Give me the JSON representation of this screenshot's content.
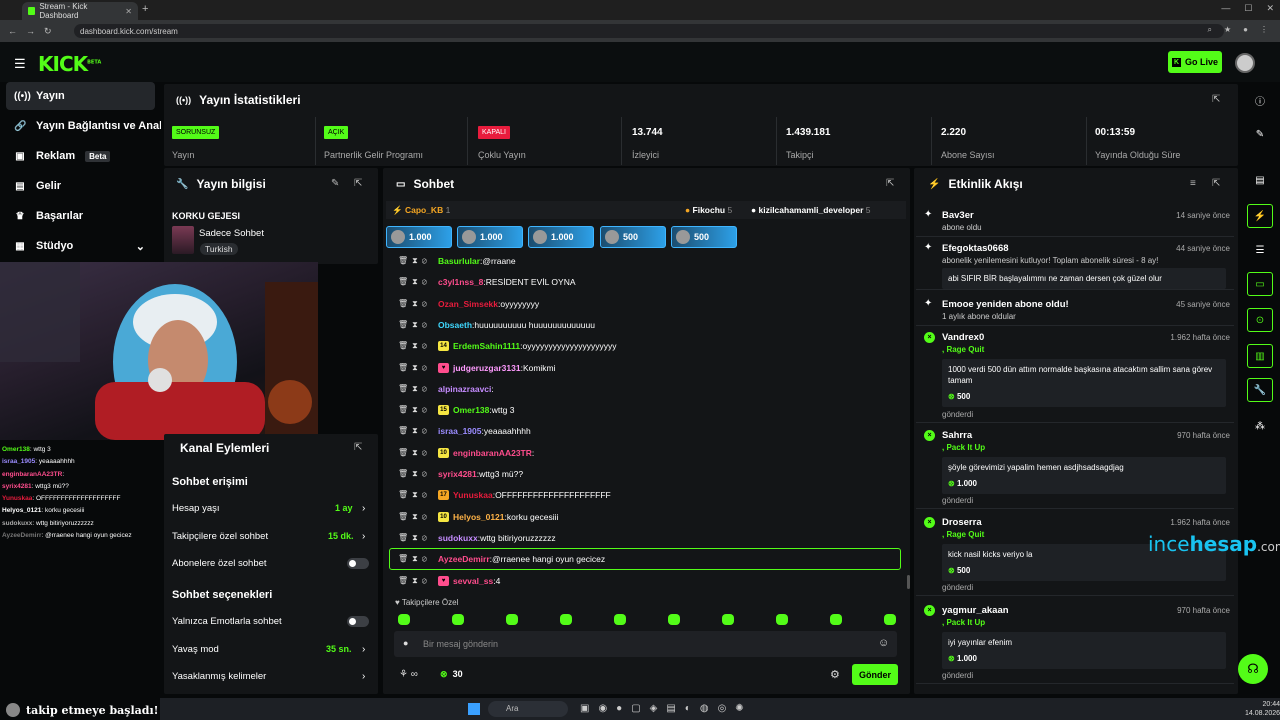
{
  "browser": {
    "tab_title": "Stream - Kick Dashboard",
    "url": "dashboard.kick.com/stream"
  },
  "header": {
    "logo": "KICK",
    "logo_sup": "BETA",
    "go_live": "Go Live"
  },
  "sidebar": {
    "items": [
      {
        "label": "Yayın",
        "icon": "broadcast-icon"
      },
      {
        "label": "Yayın Bağlantısı ve Anahtarı",
        "icon": "link-icon"
      },
      {
        "label": "Reklam",
        "icon": "ad-icon",
        "badge": "Beta"
      },
      {
        "label": "Gelir",
        "icon": "chart-icon"
      },
      {
        "label": "Başarılar",
        "icon": "trophy-icon"
      },
      {
        "label": "Stüdyo",
        "icon": "studio-icon"
      }
    ]
  },
  "stats": {
    "title": "Yayın İstatistikleri",
    "items": [
      {
        "badge": "SORUNSUZ",
        "label": "Yayın",
        "color": "#53fc18"
      },
      {
        "badge": "AÇIK",
        "label": "Partnerlik Gelir Programı",
        "color": "#53fc18"
      },
      {
        "badge": "KAPALI",
        "label": "Çoklu Yayın",
        "color": "#e81c3d"
      },
      {
        "value": "13.744",
        "label": "İzleyici"
      },
      {
        "value": "1.439.181",
        "label": "Takipçi"
      },
      {
        "value": "2.220",
        "label": "Abone Sayısı"
      },
      {
        "value": "00:13:59",
        "label": "Yayında Olduğu Süre"
      }
    ]
  },
  "info": {
    "title": "Yayın bilgisi",
    "stream_title": "KORKU GEJESI",
    "chat_mode": "Sadece Sohbet",
    "language": "Turkish"
  },
  "overlay_chat": [
    {
      "user": "Omer138",
      "msg": "wttg 3",
      "color": "#53fc18"
    },
    {
      "user": "israa_1905",
      "msg": "yeaaaahhhh",
      "color": "#9b8cff"
    },
    {
      "user": "enginbaranAA23TR",
      "msg": "",
      "color": "#ff4d8d"
    },
    {
      "user": "syrix4281",
      "msg": "wttg3 mü??",
      "color": "#ff4d8d"
    },
    {
      "user": "Yunuskaa",
      "msg": "OFFFFFFFFFFFFFFFFFFFF",
      "color": "#e81c3d"
    },
    {
      "user": "Helyos_0121",
      "msg": "korku gecesiii",
      "color": "#ffffff"
    },
    {
      "user": "sudokuxx",
      "msg": "wttg bitiriyoruzzzzzz",
      "color": "#aaaaaa"
    },
    {
      "user": "AyzeeDemirr",
      "msg": "@rraenee hangi oyun gecicez",
      "color": "#777777"
    }
  ],
  "notice": "takip etmeye başladı!",
  "actions": {
    "title": "Kanal Eylemleri",
    "access_header": "Sohbet erişimi",
    "account_age": "Hesap yaşı",
    "account_age_val": "1 ay",
    "followers_only": "Takipçilere özel sohbet",
    "followers_only_val": "15 dk.",
    "subs_only": "Abonelere özel sohbet",
    "options_header": "Sohbet seçenekleri",
    "emotes_only": "Yalnızca Emotlarla sohbet",
    "slow_mode": "Yavaş mod",
    "slow_mode_val": "35 sn.",
    "banned_words": "Yasaklanmış kelimeler"
  },
  "chat": {
    "title": "Sohbet",
    "pinned": [
      {
        "user": "Capo_KB",
        "n": "1",
        "color": "#f5a623"
      },
      {
        "user": "Fikochu",
        "n": "5",
        "color": "#f5a623"
      },
      {
        "user": "kizilcahamamli_developer",
        "n": "5",
        "color": "#fff"
      }
    ],
    "gifts": [
      "1.000",
      "1.000",
      "1.000",
      "500",
      "500"
    ],
    "messages": [
      {
        "user": "Basurlular",
        "msg": "@rraane",
        "color": "#53fc18"
      },
      {
        "user": "c3yl1nss_8",
        "msg": "RESİDENT EVİL OYNA",
        "color": "#ff4d8d"
      },
      {
        "user": "Ozan_Simsekk",
        "msg": "oyyyyyyyy",
        "color": "#e81c3d"
      },
      {
        "user": "Obsaeth",
        "msg": "huuuuuuuuuu huuuuuuuuuuuuu",
        "color": "#3fd8ff"
      },
      {
        "user": "ErdemSahin1111",
        "msg": "oyyyyyyyyyyyyyyyyyyyyy",
        "color": "#53fc18",
        "badge": "14"
      },
      {
        "user": "judgeruzgar3131",
        "msg": "Komikmi",
        "color": "#ff9bff",
        "badge": "x"
      },
      {
        "user": "alpinazraavci",
        "msg": "",
        "color": "#c58cff"
      },
      {
        "user": "Omer138",
        "msg": "wttg 3",
        "color": "#53fc18",
        "badge": "15"
      },
      {
        "user": "israa_1905",
        "msg": "yeaaaahhhh",
        "color": "#9b8cff"
      },
      {
        "user": "enginbaranAA23TR",
        "msg": "",
        "color": "#ff4d8d",
        "badge": "10"
      },
      {
        "user": "syrix4281",
        "msg": "wttg3 mü??",
        "color": "#ff4d8d"
      },
      {
        "user": "Yunuskaa",
        "msg": "OFFFFFFFFFFFFFFFFFFFFF",
        "color": "#e81c3d",
        "badge": "17"
      },
      {
        "user": "Helyos_0121",
        "msg": "korku gecesiii",
        "color": "#ffb347",
        "badge": "10"
      },
      {
        "user": "sudokuxx",
        "msg": "wttg bitiriyoruzzzzzz",
        "color": "#c58cff"
      },
      {
        "user": "AyzeeDemirr",
        "msg": "@rraenee hangi oyun gecicez",
        "color": "#ff4d8d"
      },
      {
        "user": "sevval_ss",
        "msg": "4",
        "color": "#ff4d8d",
        "badge": "x"
      }
    ],
    "followers_only": "Takipçilere Özel",
    "placeholder": "Bir mesaj gönderin",
    "count": "30",
    "send": "Gönder"
  },
  "events": {
    "title": "Etkinlik Akışı",
    "items": [
      {
        "name": "Bav3er",
        "time": "14 saniye önce",
        "sub": "abone oldu"
      },
      {
        "name": "Efegoktas0668",
        "time": "44 saniye önce",
        "sub": "abonelik yenilemesini kutluyor! Toplam abonelik süresi - 8 ay!",
        "box": "abi SIFIR BİR başlayalımmı ne zaman dersen çok güzel olur"
      },
      {
        "name": "Emooe yeniden abone oldu!",
        "time": "45 saniye önce",
        "sub": "1 aylık abone oldular"
      },
      {
        "name": "Vandrex0",
        "time": "1.962 hafta önce",
        "sub": ", Rage Quit",
        "box": "1000 verdi 500 dün attım normalde başkasına atacaktım sallim sana görev tamam",
        "amount": "500",
        "sent": "gönderdi"
      },
      {
        "name": "Sahrra",
        "time": "970 hafta önce",
        "sub": ", Pack It Up",
        "box": "şöyle görevimizi yapalim hemen asdjhsadsagdjag",
        "amount": "1.000",
        "sent": "gönderdi"
      },
      {
        "name": "Droserra",
        "time": "1.962 hafta önce",
        "sub": ", Rage Quit",
        "box": "kick nasil kicks veriyo la",
        "amount": "500",
        "sent": "gönderdi"
      },
      {
        "name": "yagmur_akaan",
        "time": "970 hafta önce",
        "sub": ", Pack It Up",
        "box": "iyi yayınlar efenim",
        "amount": "1.000",
        "sent": "gönderdi"
      }
    ]
  },
  "watermark": {
    "a": "ince",
    "b": "hesap",
    "c": ".com"
  },
  "taskbar": {
    "search": "Ara",
    "time": "20:44",
    "date": "14.08.2026"
  }
}
